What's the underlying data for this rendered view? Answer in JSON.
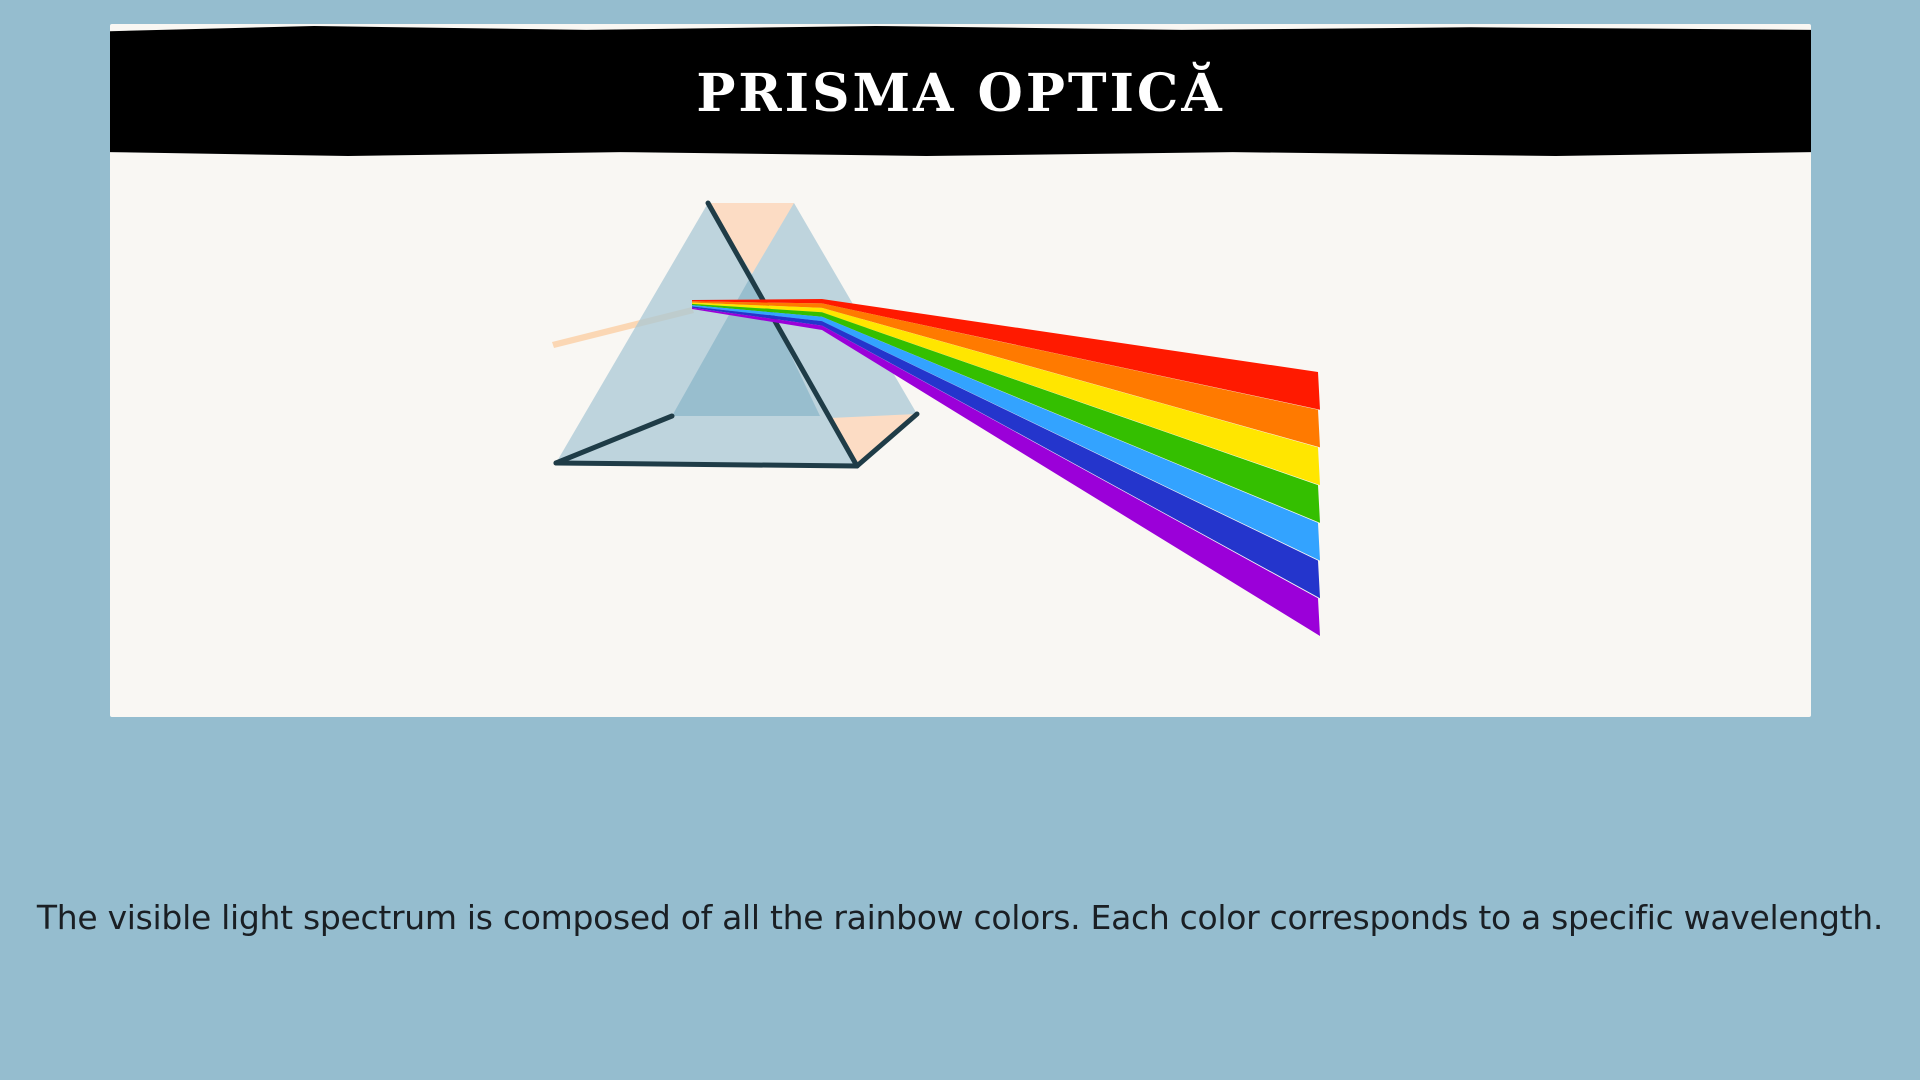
{
  "slide": {
    "title": "PRISMA OPTICĂ",
    "caption": "The visible light spectrum is composed of all the rainbow colors. Each color corresponds to a specific wavelength."
  },
  "colors": {
    "background": "#95bdcf",
    "card": "#f9f7f3",
    "title_bar": "#000000",
    "prism_glass": "#a9c8d6",
    "prism_inner": "#8fb8ca",
    "prism_edge": "#1f3c47",
    "prism_face_tint": "#fcdcc4",
    "incoming_ray": "#fbd7b4",
    "spectrum": [
      "#ff1a00",
      "#ff7a00",
      "#ffe600",
      "#34bf00",
      "#33a3ff",
      "#2435cc",
      "#9b00d9"
    ]
  },
  "illustration": {
    "subject": "prism-dispersion",
    "prism_icon": "triangular-prism-icon",
    "spectrum_icon": "rainbow-spectrum-icon",
    "ray_icon": "white-light-ray-icon"
  }
}
